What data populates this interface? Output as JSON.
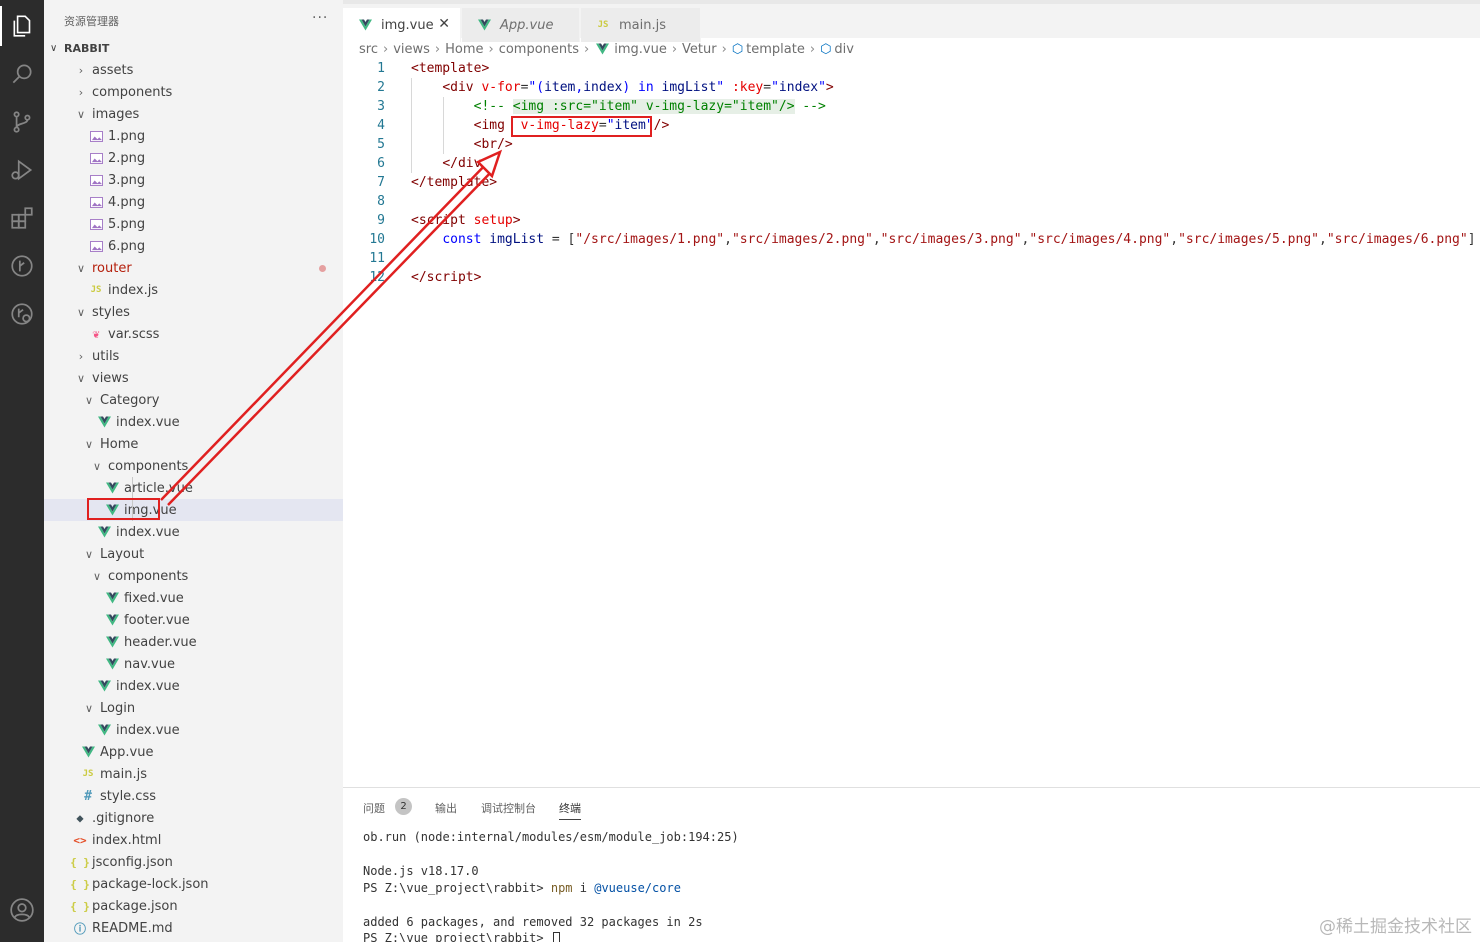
{
  "sidebar": {
    "title": "资源管理器",
    "more": "···",
    "root_label": "RABBIT",
    "tree": [
      {
        "label": "assets",
        "type": "folder",
        "open": false,
        "depth": 1
      },
      {
        "label": "components",
        "type": "folder",
        "open": false,
        "depth": 1
      },
      {
        "label": "images",
        "type": "folder",
        "open": true,
        "depth": 1
      },
      {
        "label": "1.png",
        "type": "png",
        "depth": 2
      },
      {
        "label": "2.png",
        "type": "png",
        "depth": 2
      },
      {
        "label": "3.png",
        "type": "png",
        "depth": 2
      },
      {
        "label": "4.png",
        "type": "png",
        "depth": 2
      },
      {
        "label": "5.png",
        "type": "png",
        "depth": 2
      },
      {
        "label": "6.png",
        "type": "png",
        "depth": 2
      },
      {
        "label": "router",
        "type": "folder",
        "open": true,
        "depth": 1,
        "modified": true
      },
      {
        "label": "index.js",
        "type": "js",
        "depth": 2
      },
      {
        "label": "styles",
        "type": "folder",
        "open": true,
        "depth": 1
      },
      {
        "label": "var.scss",
        "type": "scss",
        "depth": 2
      },
      {
        "label": "utils",
        "type": "folder",
        "open": false,
        "depth": 1
      },
      {
        "label": "views",
        "type": "folder",
        "open": true,
        "depth": 1
      },
      {
        "label": "Category",
        "type": "folder",
        "open": true,
        "depth": 2
      },
      {
        "label": "index.vue",
        "type": "vue",
        "depth": 3
      },
      {
        "label": "Home",
        "type": "folder",
        "open": true,
        "depth": 2
      },
      {
        "label": "components",
        "type": "folder",
        "open": true,
        "depth": 3
      },
      {
        "label": "article.vue",
        "type": "vue",
        "depth": 4
      },
      {
        "label": "img.vue",
        "type": "vue",
        "depth": 4,
        "selected": true
      },
      {
        "label": "index.vue",
        "type": "vue",
        "depth": 3
      },
      {
        "label": "Layout",
        "type": "folder",
        "open": true,
        "depth": 2
      },
      {
        "label": "components",
        "type": "folder",
        "open": true,
        "depth": 3
      },
      {
        "label": "fixed.vue",
        "type": "vue",
        "depth": 4
      },
      {
        "label": "footer.vue",
        "type": "vue",
        "depth": 4
      },
      {
        "label": "header.vue",
        "type": "vue",
        "depth": 4
      },
      {
        "label": "nav.vue",
        "type": "vue",
        "depth": 4
      },
      {
        "label": "index.vue",
        "type": "vue",
        "depth": 3
      },
      {
        "label": "Login",
        "type": "folder",
        "open": true,
        "depth": 2
      },
      {
        "label": "index.vue",
        "type": "vue",
        "depth": 3
      },
      {
        "label": "App.vue",
        "type": "vue",
        "depth": 1
      },
      {
        "label": "main.js",
        "type": "js",
        "depth": 1
      },
      {
        "label": "style.css",
        "type": "css",
        "depth": 1
      },
      {
        "label": ".gitignore",
        "type": "git",
        "depth": 0
      },
      {
        "label": "index.html",
        "type": "html",
        "depth": 0
      },
      {
        "label": "jsconfig.json",
        "type": "json",
        "depth": 0
      },
      {
        "label": "package-lock.json",
        "type": "json",
        "depth": 0
      },
      {
        "label": "package.json",
        "type": "json",
        "depth": 0
      },
      {
        "label": "README.md",
        "type": "info",
        "depth": 0
      }
    ]
  },
  "tabs": [
    {
      "label": "img.vue",
      "icon": "vue",
      "active": true,
      "close": "✕"
    },
    {
      "label": "App.vue",
      "icon": "vue",
      "italic": true
    },
    {
      "label": "main.js",
      "icon": "js"
    }
  ],
  "breadcrumb": [
    "src",
    "views",
    "Home",
    "components",
    "img.vue",
    "Vetur",
    "template",
    "div"
  ],
  "editor": {
    "line_numbers": [
      "1",
      "2",
      "3",
      "4",
      "5",
      "6",
      "7",
      "8",
      "9",
      "10",
      "11",
      "12"
    ]
  },
  "panel": {
    "tabs": [
      {
        "label": "问题",
        "badge": "2"
      },
      {
        "label": "输出"
      },
      {
        "label": "调试控制台"
      },
      {
        "label": "终端",
        "active": true
      }
    ],
    "terminal": {
      "line1": "ob.run (node:internal/modules/esm/module_job:194:25)",
      "line2": "Node.js v18.17.0",
      "prompt": "PS Z:\\vue_project\\rabbit> ",
      "cmd": "npm",
      "cmd_args": " i ",
      "pkg": "@vueuse/core",
      "line4": "added 6 packages, and removed 32 packages in 2s",
      "prompt2": "PS Z:\\vue_project\\rabbit> "
    }
  },
  "watermark": "@稀土掘金技术社区",
  "colors": {
    "activity_bar": "#2c2c2c",
    "sidebar": "#f3f3f3",
    "vue_green": "#41b883",
    "annotation_red": "#e02020"
  }
}
